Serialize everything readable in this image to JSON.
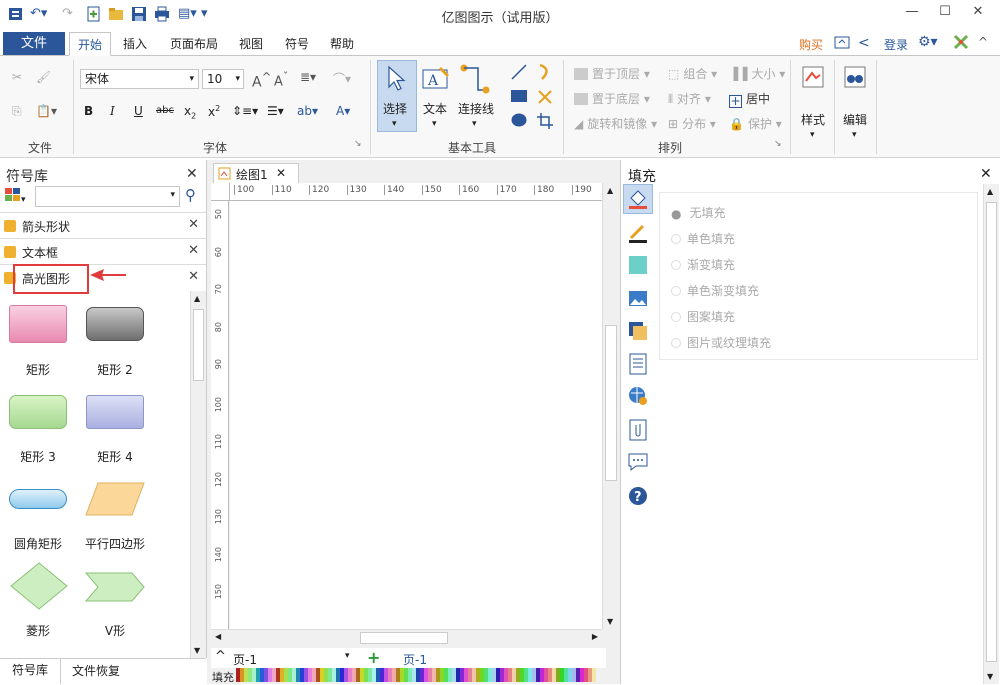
{
  "window": {
    "title": "亿图图示（试用版）",
    "minimize_glyph": "—",
    "maximize_glyph": "☐",
    "close_glyph": "✕"
  },
  "menu": {
    "file": "文件",
    "tabs": [
      "开始",
      "插入",
      "页面布局",
      "视图",
      "符号",
      "帮助"
    ],
    "buy": "购买",
    "login": "登录"
  },
  "ribbon": {
    "file_group": "文件",
    "font_group": "字体",
    "font_name": "宋体",
    "font_size": "10",
    "basic_tools_group": "基本工具",
    "select": "选择",
    "text": "文本",
    "connector": "连接线",
    "arrange_group": "排列",
    "bring_front": "置于顶层",
    "send_back": "置于底层",
    "rotate_mirror": "旋转和镜像",
    "group": "组合",
    "align": "对齐",
    "distribute": "分布",
    "size": "大小",
    "center": "居中",
    "protect": "保护",
    "style": "样式",
    "edit": "编辑"
  },
  "left_panel": {
    "title": "符号库",
    "categories": [
      "箭头形状",
      "文本框",
      "高光图形"
    ],
    "shapes": [
      "矩形",
      "矩形 2",
      "矩形 3",
      "矩形 4",
      "圆角矩形",
      "平行四边形",
      "菱形",
      "V形"
    ],
    "bottom_tabs": [
      "符号库",
      "文件恢复"
    ]
  },
  "canvas": {
    "doc_tab": "绘图1",
    "ruler_h": [
      "100",
      "110",
      "120",
      "130",
      "140",
      "150",
      "160",
      "170",
      "180",
      "190"
    ],
    "ruler_v": [
      "50",
      "60",
      "70",
      "80",
      "90",
      "100",
      "110",
      "120",
      "130",
      "140",
      "150"
    ],
    "page": "页-1",
    "page_tab": "页-1",
    "fill_label": "填充"
  },
  "right_panel": {
    "title": "填充",
    "options": [
      "无填充",
      "单色填充",
      "渐变填充",
      "单色渐变填充",
      "图案填充",
      "图片或纹理填充"
    ]
  },
  "colors": {
    "accent": "#2b579a",
    "highlight": "#e23b3b"
  }
}
